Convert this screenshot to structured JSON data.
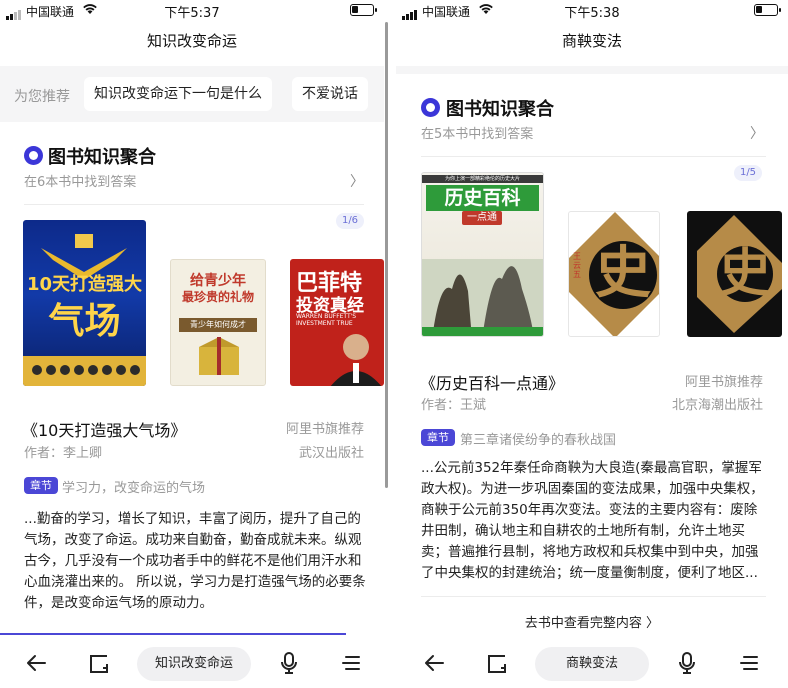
{
  "screens": [
    {
      "status": {
        "carrier": "中国联通",
        "time": "下午5:37"
      },
      "nav_title": "知识改变命运",
      "recommend": {
        "label": "为您推荐",
        "chips": [
          "知识改变命运下一句是什么",
          "不爱说话"
        ]
      },
      "section": {
        "title": "图书知识聚合",
        "subtitle": "在6本书中找到答案",
        "pager": "1/6"
      },
      "covers": [
        {
          "text1": "10天打造强大",
          "text2": "气场"
        },
        {
          "text1": "给青少年",
          "text2": "最珍贵的礼物",
          "text3": "青少年如何成才"
        },
        {
          "text1": "巴菲特",
          "text2": "投资真经",
          "text3": "WARREN BUFFETT'S INVESTMENT TRUE"
        }
      ],
      "book": {
        "title": "《10天打造强大气场》",
        "source": "阿里书旗推荐",
        "author": "作者：李上卿",
        "publisher": "武汉出版社"
      },
      "chapter": {
        "tag": "章节",
        "title": "学习力，改变命运的气场"
      },
      "excerpt": "...勤奋的学习，增长了知识，丰富了阅历，提升了自己的气场，改变了命运。成功来自勤奋，勤奋成就未来。纵观古今，几乎没有一个成功者手中的鲜花不是他们用汗水和心血浇灌出来的。 所以说，学习力是打造强气场的必要条件，是改变命运气场的原动力。",
      "toolbar": {
        "center": "知识改变命运",
        "progress": 0.9
      }
    },
    {
      "status": {
        "carrier": "中国联通",
        "time": "下午5:38"
      },
      "nav_title": "商鞅变法",
      "section": {
        "title": "图书知识聚合",
        "subtitle": "在5本书中找到答案",
        "pager": "1/5"
      },
      "covers": [
        {
          "text0": "为你上演一部精彩绝伦的历史大片",
          "text1": "历史百科",
          "text2": "一点通"
        },
        {
          "text1": "史",
          "text2": "王云五"
        },
        {
          "text1": "史"
        }
      ],
      "book": {
        "title": "《历史百科一点通》",
        "source": "阿里书旗推荐",
        "author": "作者：王斌",
        "publisher": "北京海潮出版社"
      },
      "chapter": {
        "tag": "章节",
        "title": "第三章诸侯纷争的春秋战国"
      },
      "excerpt": "...公元前352年秦任命商鞅为大良造(秦最高官职，掌握军政大权)。为进一步巩固秦国的变法成果，加强中央集权，商鞅于公元前350年再次变法。变法的主要内容有：废除井田制，确认地主和自耕农的土地所有制，允许土地买卖；普遍推行县制，将地方政权和兵权集中到中央，加强了中央集权的封建统治；统一度量衡制度，便利了地区...",
      "cta": "去书中查看完整内容 〉",
      "toolbar": {
        "center": "商鞅变法"
      }
    }
  ]
}
